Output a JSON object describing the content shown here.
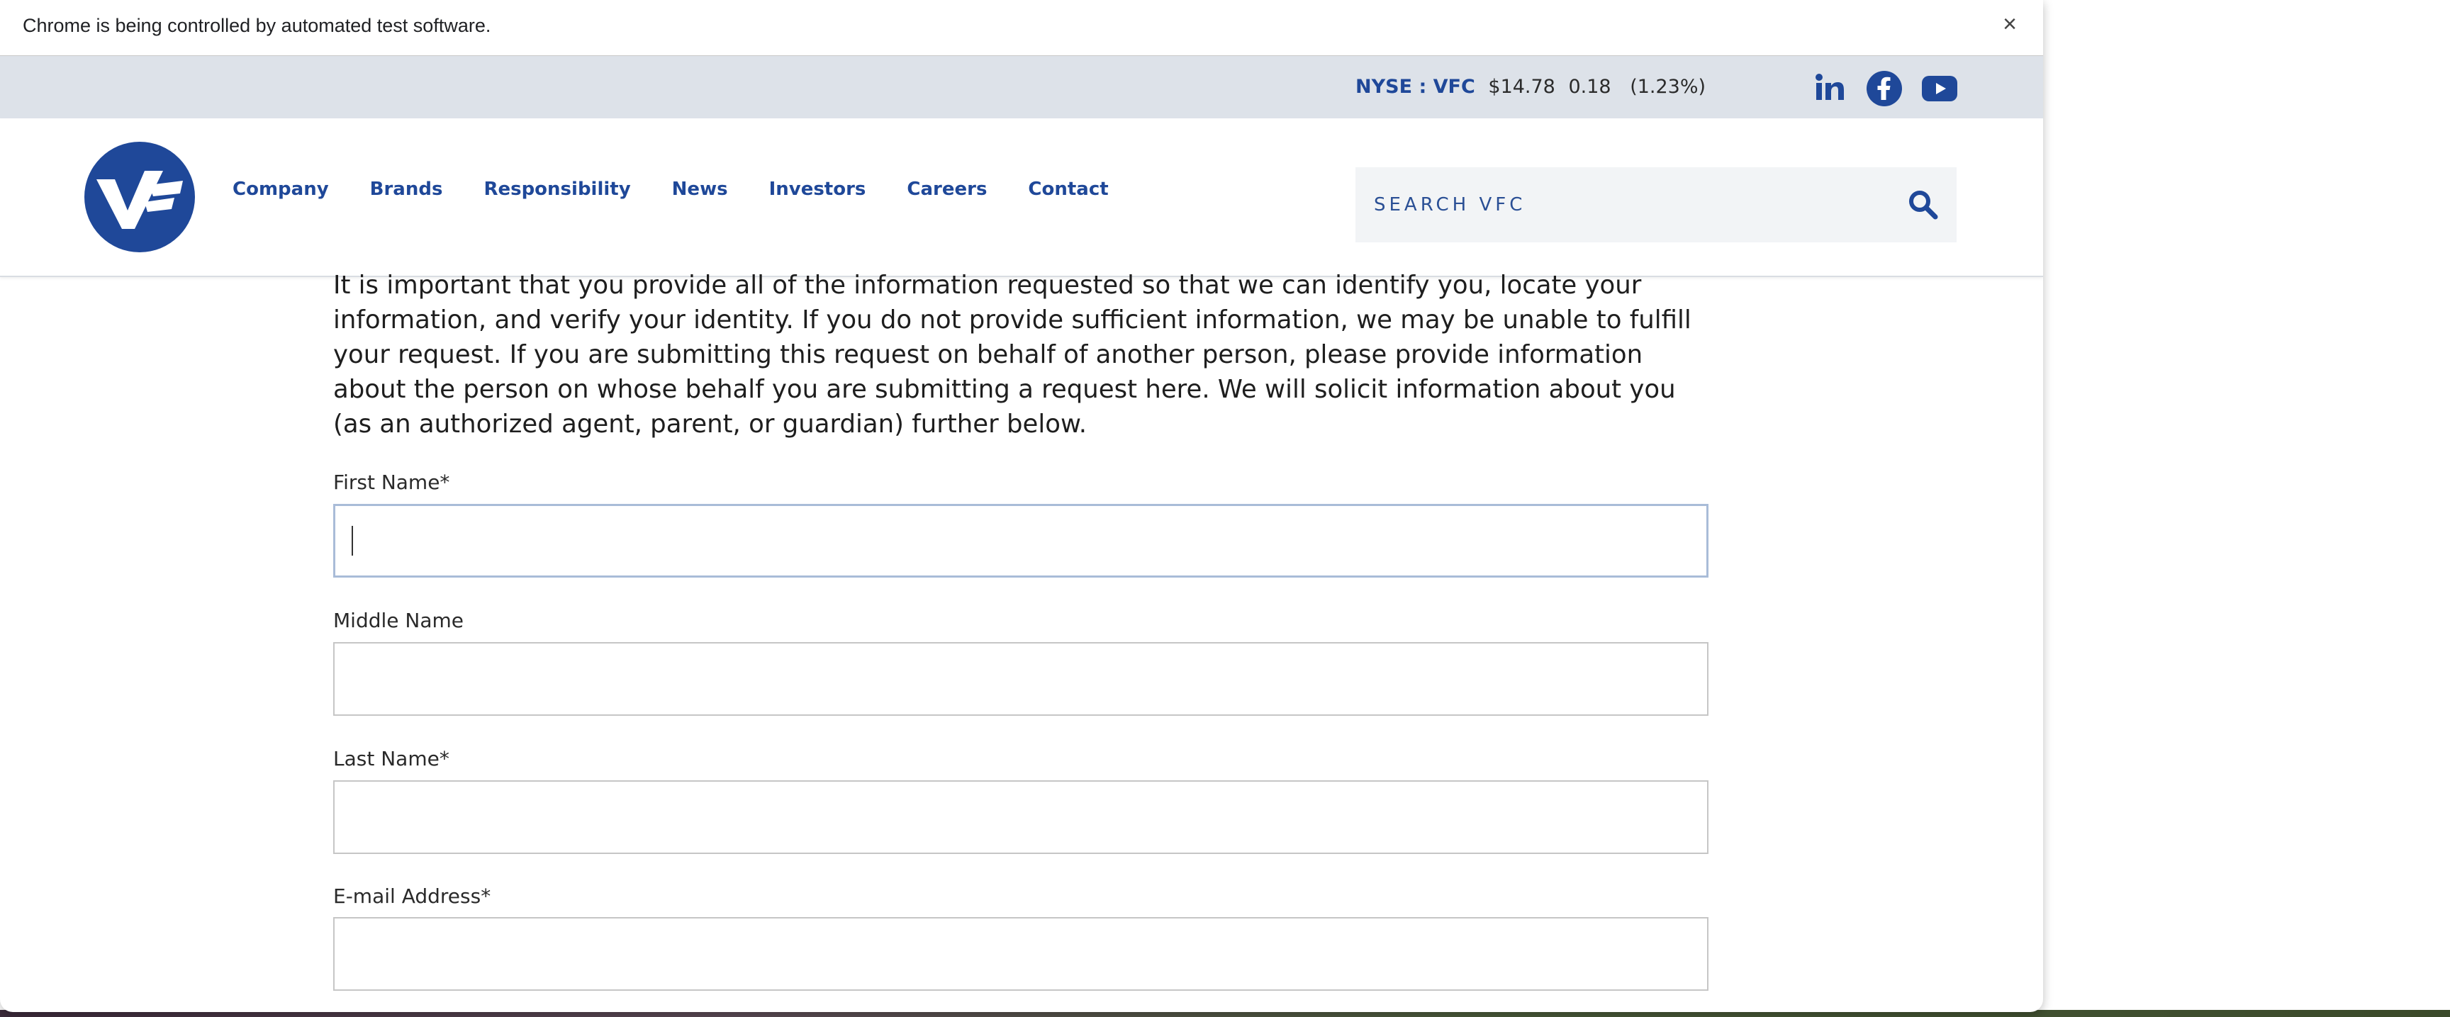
{
  "infobar": {
    "message": "Chrome is being controlled by automated test software.",
    "close_glyph": "×"
  },
  "stock": {
    "symbol": "NYSE : VFC",
    "price": "$14.78",
    "change": "0.18",
    "percent": "(1.23%)"
  },
  "social": [
    "linkedin-icon",
    "facebook-icon",
    "youtube-icon"
  ],
  "brand": {
    "color": "#1f4899",
    "logo_text": "VF"
  },
  "nav": {
    "items": [
      {
        "label": "Company"
      },
      {
        "label": "Brands"
      },
      {
        "label": "Responsibility"
      },
      {
        "label": "News"
      },
      {
        "label": "Investors"
      },
      {
        "label": "Careers"
      },
      {
        "label": "Contact"
      }
    ]
  },
  "search": {
    "placeholder": "SEARCH VFC",
    "value": ""
  },
  "content": {
    "intro": "It is important that you provide all of the information requested so that we can identify you, locate your information, and verify your identity. If you do not provide sufficient information, we may be unable to fulfill your request. If you are submitting this request on behalf of another person, please provide information about the person on whose behalf you are submitting a request here. We will solicit information about you (as an authorized agent, parent, or guardian) further below."
  },
  "form": {
    "first_name": {
      "label": "First Name*",
      "value": ""
    },
    "middle_name": {
      "label": "Middle Name",
      "value": ""
    },
    "last_name": {
      "label": "Last Name*",
      "value": ""
    },
    "email": {
      "label": "E-mail Address*",
      "value": ""
    }
  }
}
